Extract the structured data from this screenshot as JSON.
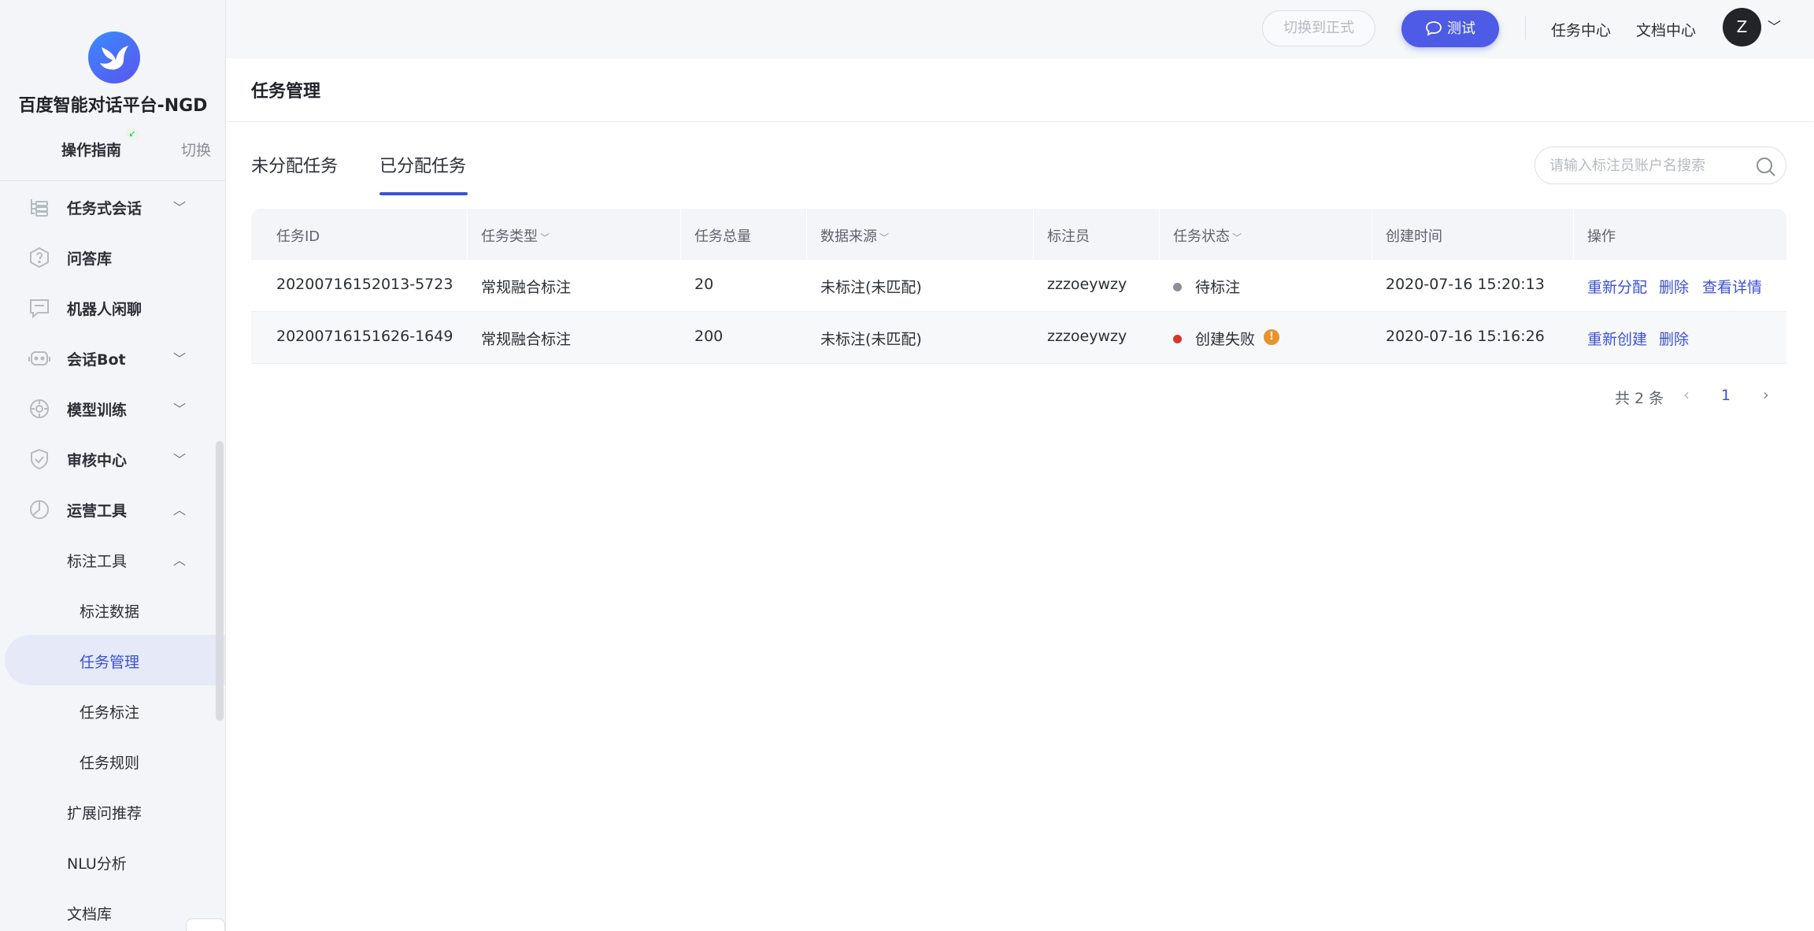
{
  "sidebar": {
    "brand": "百度智能对话平台-NGD",
    "guide": "操作指南",
    "switch": "切换",
    "items": [
      {
        "label": "任务式会话",
        "icon": "flow-icon",
        "chev": "﹀"
      },
      {
        "label": "问答库",
        "icon": "question-icon"
      },
      {
        "label": "机器人闲聊",
        "icon": "chat-icon"
      },
      {
        "label": "会话Bot",
        "icon": "bot-icon",
        "chev": "﹀"
      },
      {
        "label": "模型训练",
        "icon": "model-icon",
        "chev": "﹀"
      },
      {
        "label": "审核中心",
        "icon": "shield-icon",
        "chev": "﹀"
      },
      {
        "label": "运营工具",
        "icon": "pie-icon",
        "chev": "︿"
      }
    ],
    "sub": {
      "label": "标注工具",
      "chev": "︿"
    },
    "subsub": [
      "标注数据",
      "任务管理",
      "任务标注",
      "任务规则"
    ],
    "tail": [
      "扩展问推荐",
      "NLU分析",
      "文档库"
    ]
  },
  "header": {
    "formal_button": "切换到正式",
    "test_button": "测试",
    "task_center": "任务中心",
    "doc_center": "文档中心",
    "avatar": "Z"
  },
  "page": {
    "title": "任务管理",
    "tabs": [
      "未分配任务",
      "已分配任务"
    ],
    "active_tab": 1,
    "search_placeholder": "请输入标注员账户名搜索"
  },
  "table": {
    "columns": [
      "任务ID",
      "任务类型",
      "任务总量",
      "数据来源",
      "标注员",
      "任务状态",
      "创建时间",
      "操作"
    ],
    "rows": [
      {
        "id": "20200716152013-5723",
        "type": "常规融合标注",
        "total": "20",
        "source": "未标注(未匹配)",
        "annotator": "zzzoeywzy",
        "status": "待标注",
        "status_color": "#8a8f99",
        "created": "2020-07-16 15:20:13",
        "actions": [
          "重新分配",
          "删除",
          "查看详情"
        ]
      },
      {
        "id": "20200716151626-1649",
        "type": "常规融合标注",
        "total": "200",
        "source": "未标注(未匹配)",
        "annotator": "zzzoeywzy",
        "status": "创建失败",
        "status_color": "#d4382c",
        "created": "2020-07-16 15:16:26",
        "actions": [
          "重新创建",
          "删除"
        ]
      }
    ]
  },
  "pager": {
    "total": "共 2 条",
    "current": "1"
  },
  "colors": {
    "accent": "#3b52d4",
    "test_button": "#4d5be6",
    "warning": "#e8932c"
  }
}
